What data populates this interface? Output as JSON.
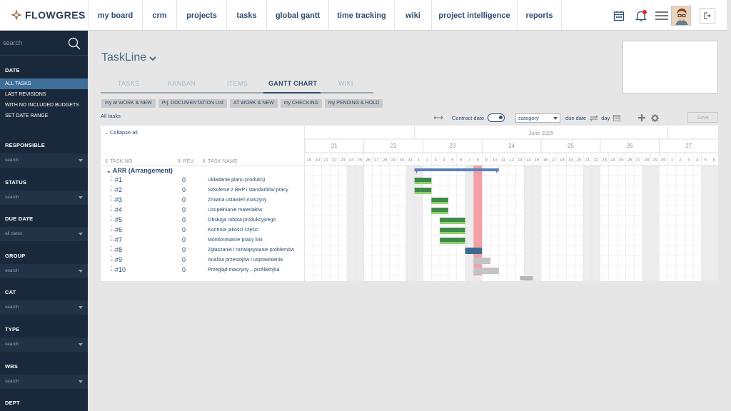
{
  "app": {
    "logo_text": "FLOWGRES"
  },
  "nav": [
    {
      "label": "my board",
      "w": 76
    },
    {
      "label": "crm",
      "w": 48
    },
    {
      "label": "projects",
      "w": 70
    },
    {
      "label": "tasks",
      "w": 56
    },
    {
      "label": "global gantt",
      "w": 87
    },
    {
      "label": "time tracking",
      "w": 92
    },
    {
      "label": "wiki",
      "w": 52
    },
    {
      "label": "project intelligence",
      "w": 120
    },
    {
      "label": "reports",
      "w": 63
    }
  ],
  "sidebar": {
    "search_placeholder": "search",
    "date_heading": "DATE",
    "date_items": [
      {
        "label": "ALL TASKS",
        "active": true
      },
      {
        "label": "LAST REVISIONS",
        "active": false
      },
      {
        "label": "WITH NO INCLUDED BUDGETS",
        "active": false
      },
      {
        "label": "SET DATE RANGE",
        "active": false
      }
    ],
    "filters": [
      {
        "heading": "RESPONSIBLE",
        "value": "search"
      },
      {
        "heading": "STATUS",
        "value": "search"
      },
      {
        "heading": "DUE DATE",
        "value": "all dates"
      },
      {
        "heading": "GROUP",
        "value": "search"
      },
      {
        "heading": "CAT",
        "value": "search"
      },
      {
        "heading": "TYPE",
        "value": "search"
      },
      {
        "heading": "WBS",
        "value": "search"
      },
      {
        "heading": "DEPT",
        "value": ""
      }
    ]
  },
  "page": {
    "title": "TaskLine"
  },
  "tabs": [
    {
      "label": "TASKS",
      "active": false
    },
    {
      "label": "KANBAN",
      "active": false
    },
    {
      "label": "ITEMS",
      "active": false
    },
    {
      "label": "GANTT CHART",
      "active": true
    },
    {
      "label": "WIKI",
      "active": false
    }
  ],
  "filter_buttons": [
    "my at WORK & NEW",
    "Prj. DOCUMENTATION List",
    "AT WORK & NEW",
    "my CHECKING",
    "my PENDING & HOLD"
  ],
  "all_tasks_label": "All tasks",
  "toolbar": {
    "contract_date": "Contract date",
    "category_select": "category",
    "due_date": "due date",
    "day": "day",
    "save": "Save"
  },
  "grid": {
    "collapse_all": "Collapse all",
    "col_task_no": "TASK NO",
    "col_rev": "REV.",
    "col_task_name": "TASK NAME",
    "group_label": "ARR (Arrangement)",
    "tasks": [
      {
        "no": "#1",
        "rev": "0",
        "name": "Układanie planu produkcji",
        "start": 6,
        "dur": 2,
        "color": "green"
      },
      {
        "no": "#2",
        "rev": "0",
        "name": "Szkolenie z BHP i standardów pracy",
        "start": 6,
        "dur": 2,
        "color": "green"
      },
      {
        "no": "#3",
        "rev": "0",
        "name": "Zmiana ustawień maszyny",
        "start": 8,
        "dur": 2,
        "color": "green"
      },
      {
        "no": "#4",
        "rev": "0",
        "name": "Uzupełnianie materiałów",
        "start": 8,
        "dur": 2,
        "color": "green"
      },
      {
        "no": "#5",
        "rev": "0",
        "name": "Obsługa robota produkcyjnego",
        "start": 9,
        "dur": 3,
        "color": "green"
      },
      {
        "no": "#6",
        "rev": "0",
        "name": "Kontrola jakości części",
        "start": 9,
        "dur": 3,
        "color": "green"
      },
      {
        "no": "#7",
        "rev": "0",
        "name": "Monitorowanie pracy linii",
        "start": 9,
        "dur": 3,
        "color": "green"
      },
      {
        "no": "#8",
        "rev": "0",
        "name": "Zgłaszanie i rozwiązywanie problemów",
        "start": 12,
        "dur": 2,
        "color": "blue"
      },
      {
        "no": "#9",
        "rev": "0",
        "name": "Analiza przestojów i usprawnienia",
        "start": 13,
        "dur": 2,
        "color": "gray"
      },
      {
        "no": "#10",
        "rev": "0",
        "name": "Przegląd maszyny – profilaktyka",
        "start": 13,
        "dur": 3,
        "color": "gray"
      }
    ]
  },
  "gantt": {
    "month_label": "June 2025",
    "weeks": [
      "21",
      "22",
      "23",
      "24",
      "25",
      "26",
      "27"
    ],
    "days": [
      "19",
      "20",
      "21",
      "22",
      "23",
      "24",
      "25",
      "26",
      "27",
      "28",
      "29",
      "30",
      "31",
      "1",
      "2",
      "3",
      "4",
      "5",
      "6",
      "7",
      "8",
      "9",
      "10",
      "11",
      "12",
      "13",
      "14",
      "15",
      "16",
      "17",
      "18",
      "19",
      "20",
      "21",
      "22",
      "23",
      "24",
      "25",
      "26",
      "27",
      "28",
      "29",
      "30",
      "1",
      "2",
      "3",
      "4",
      "5",
      "6"
    ],
    "weekend_days": [
      5,
      6,
      12,
      13,
      19,
      20,
      26,
      27,
      33,
      34,
      40,
      41,
      47,
      48
    ],
    "today_index": 20,
    "summary": {
      "start": 13,
      "end": 23
    },
    "extra_bar": {
      "start": 25.5,
      "dur": 1.5,
      "row": 10
    },
    "task_offset_days": 7,
    "colors": {
      "green": "#3f8a4a",
      "green_light": "#8fd16a",
      "blue": "#3d6a8f",
      "gray": "#c4c4c4",
      "summary": "#5b7fbf",
      "today": "#f2a0a5",
      "weekend": "#ececec"
    }
  }
}
